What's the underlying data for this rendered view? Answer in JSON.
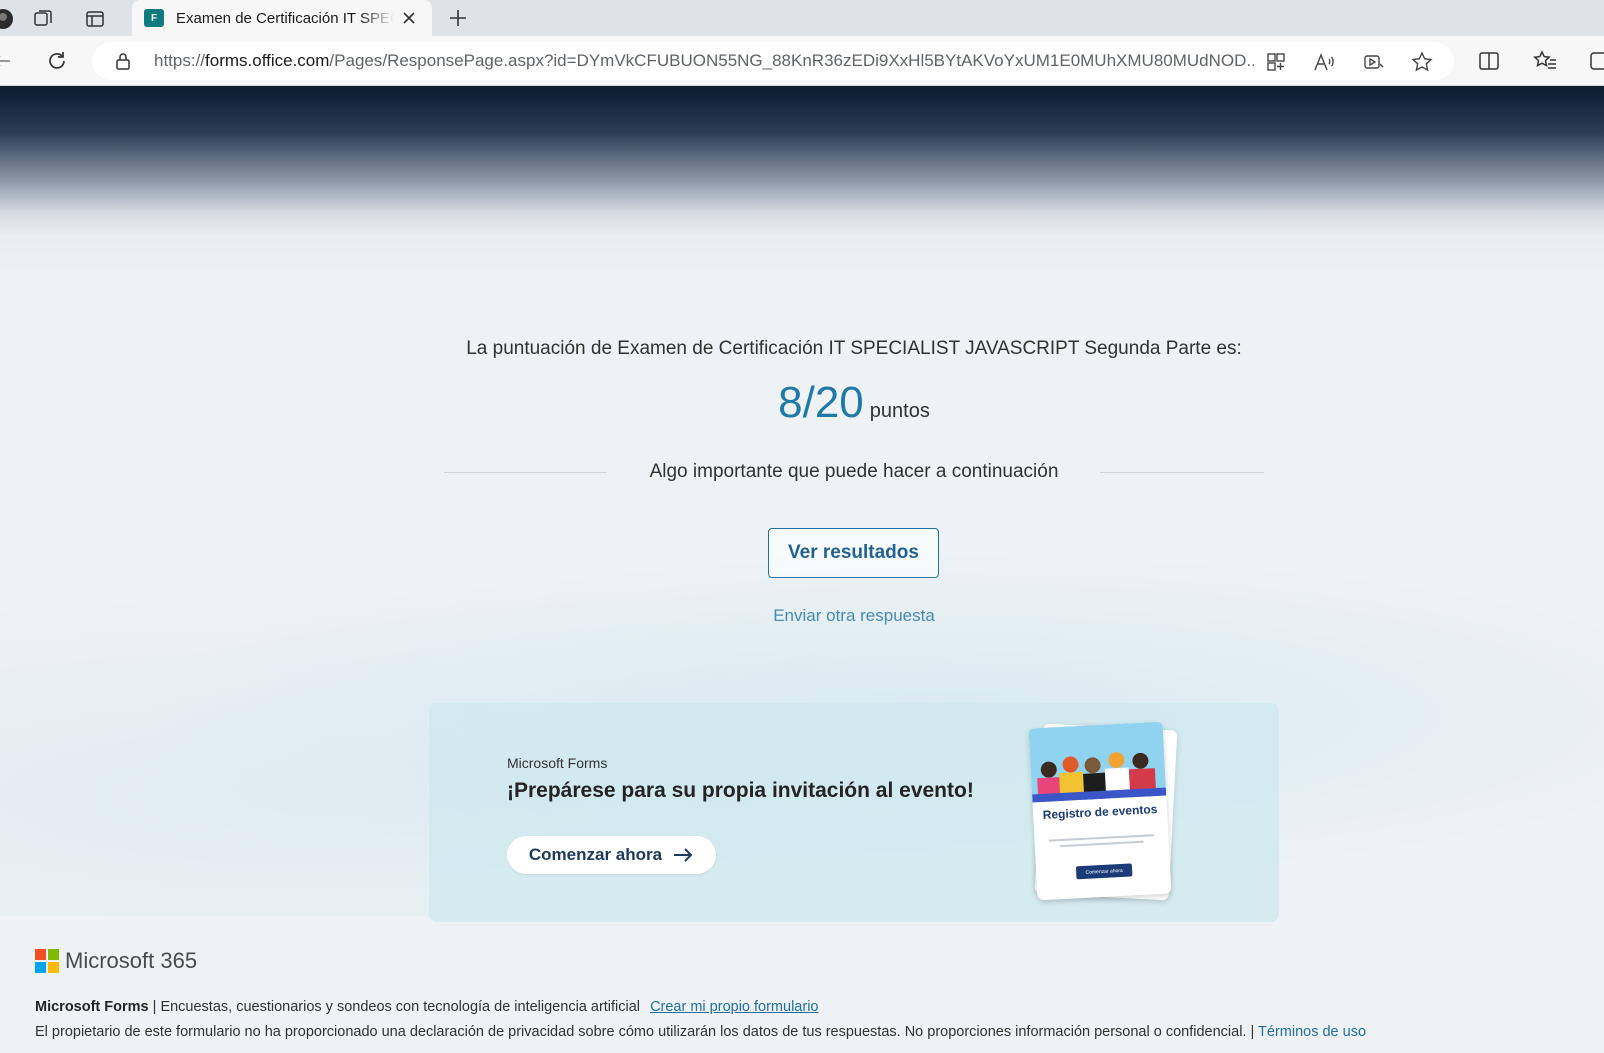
{
  "browser": {
    "tab_title": "Examen de Certificación IT SPECIALIST JAVASCRIPT Segunda Parte",
    "tab_favicon_text": "F",
    "url_prefix": "https://",
    "url_host": "forms.office.com",
    "url_path": "/Pages/ResponsePage.aspx?id=DYmVkCFUBUON55NG_88KnR36zEDi9XxHl5BYtAKVoYxUM1E0MUhXMU80MUdNOD..."
  },
  "result": {
    "score_text": "La puntuación de Examen de Certificación IT SPECIALIST JAVASCRIPT Segunda Parte es:",
    "score_value": "8/20",
    "score_unit": "puntos",
    "next_title": "Algo importante que puede hacer a continuación",
    "view_results_label": "Ver resultados",
    "submit_another_label": "Enviar otra respuesta"
  },
  "promo": {
    "brand": "Microsoft Forms",
    "title": "¡Prepárese para su propia invitación al evento!",
    "button_label": "Comenzar ahora",
    "card_title": "Registro de eventos",
    "card_button": "Comenzar ahora"
  },
  "footer": {
    "logo_text": "Microsoft 365",
    "logo_colors": [
      "#f25022",
      "#7fba00",
      "#00a4ef",
      "#ffb900"
    ],
    "product": "Microsoft Forms",
    "separator": "|",
    "tagline": "Encuestas, cuestionarios y sondeos con tecnología de inteligencia artificial",
    "create_link": "Crear mi propio formulario",
    "privacy_text": "El propietario de este formulario no ha proporcionado una declaración de privacidad sobre cómo utilizarán los datos de tus respuestas. No proporciones información personal o confidencial. |",
    "terms_link": "Términos de uso"
  },
  "colors": {
    "accent": "#1f7aa8",
    "link": "#1f6fa3",
    "promo_bg": "#d0eaee",
    "header_dark": "#0c1b2e"
  }
}
